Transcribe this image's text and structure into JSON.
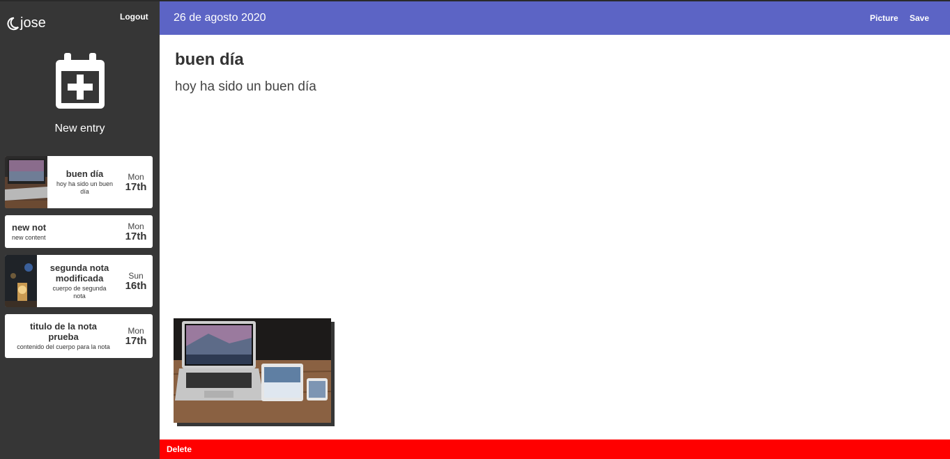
{
  "sidebar": {
    "brand": "jose",
    "logout_label": "Logout",
    "new_entry_label": "New entry",
    "entries": [
      {
        "title": "buen día",
        "snippet": "hoy ha sido un buen día",
        "day": "Mon",
        "date": "17th",
        "has_image": true
      },
      {
        "title": "new not",
        "snippet": "new content",
        "day": "Mon",
        "date": "17th",
        "has_image": false
      },
      {
        "title": "segunda nota modificada",
        "snippet": "cuerpo de segunda nota",
        "day": "Sun",
        "date": "16th",
        "has_image": true
      },
      {
        "title": "titulo de la nota prueba",
        "snippet": "contenido del cuerpo para la nota",
        "day": "Mon",
        "date": "17th",
        "has_image": false
      }
    ]
  },
  "topbar": {
    "date_title": "26 de agosto 2020",
    "picture_label": "Picture",
    "save_label": "Save"
  },
  "note": {
    "title": "buen día",
    "body": "hoy ha sido un buen día"
  },
  "footer": {
    "delete_label": "Delete"
  },
  "colors": {
    "sidebar_bg": "#363636",
    "topbar_bg": "#5c64c5",
    "delete_bg": "#ff0000"
  }
}
